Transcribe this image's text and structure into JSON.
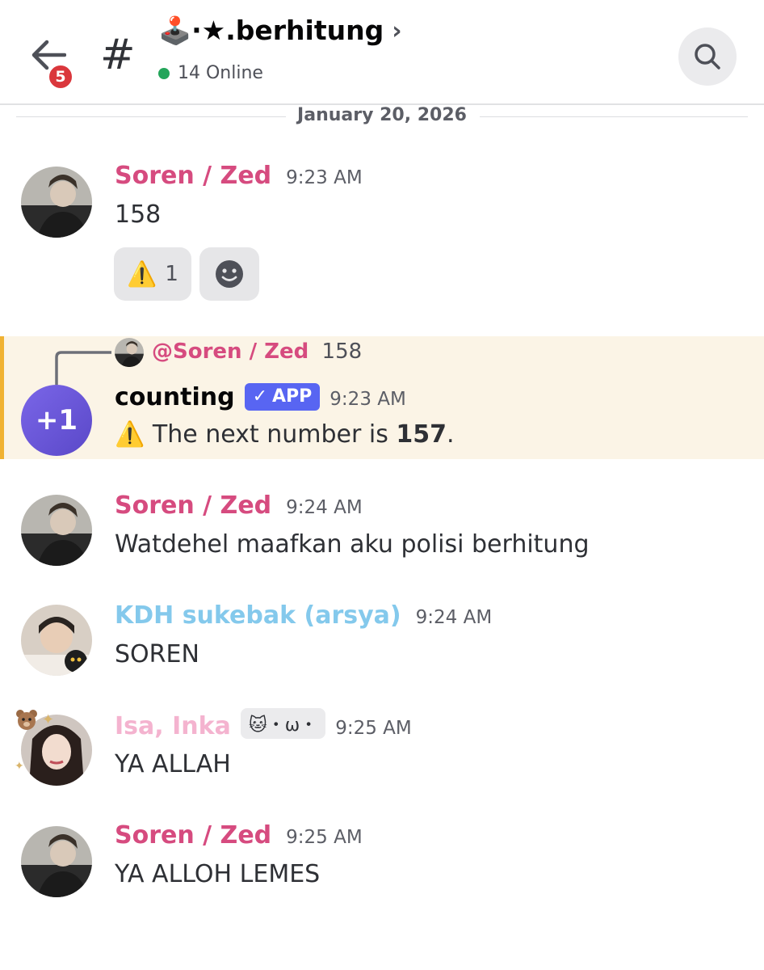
{
  "header": {
    "back_badge": "5",
    "hash": "#",
    "channel_name": "🕹️·★.berhitung",
    "chevron": "›",
    "online": "14 Online"
  },
  "date_divider": "January 20, 2026",
  "messages": [
    {
      "author": "Soren / Zed",
      "time": "9:23 AM",
      "text": "158"
    },
    {
      "author": "Soren / Zed",
      "time": "9:24 AM",
      "text": "Watdehel maafkan aku polisi berhitung"
    },
    {
      "author": "KDH sukebak (arsya)",
      "time": "9:24 AM",
      "text": "SOREN"
    },
    {
      "author": "Isa, Inka",
      "tag": "🐱・ω・",
      "time": "9:25 AM",
      "text": "YA ALLAH"
    },
    {
      "author": "Soren / Zed",
      "time": "9:25 AM",
      "text": "YA ALLOH LEMES"
    }
  ],
  "reaction": {
    "emoji": "⚠️",
    "count": "1"
  },
  "bot": {
    "reply_author": "@Soren / Zed",
    "reply_text": "158",
    "author": "counting",
    "app_tag": "APP",
    "time": "9:23 AM",
    "avatar_text": "+1",
    "warn": "⚠️",
    "text_prefix": "The next number is ",
    "number": "157",
    "text_suffix": "."
  },
  "colors": {
    "soren": "#d64b7f",
    "kdh": "#84c9ec",
    "isa": "#f4b3cf",
    "highlight_bg": "#fbf4e6",
    "highlight_bar": "#f0b232",
    "app_tag": "#5865f2",
    "online": "#23a55a",
    "badge": "#da373c"
  },
  "icons": [
    "back-arrow-icon",
    "hash-icon",
    "joystick-icon",
    "chevron-right-icon",
    "search-icon",
    "add-reaction-icon",
    "warning-icon",
    "reply-line-icon",
    "checkmark-icon"
  ]
}
